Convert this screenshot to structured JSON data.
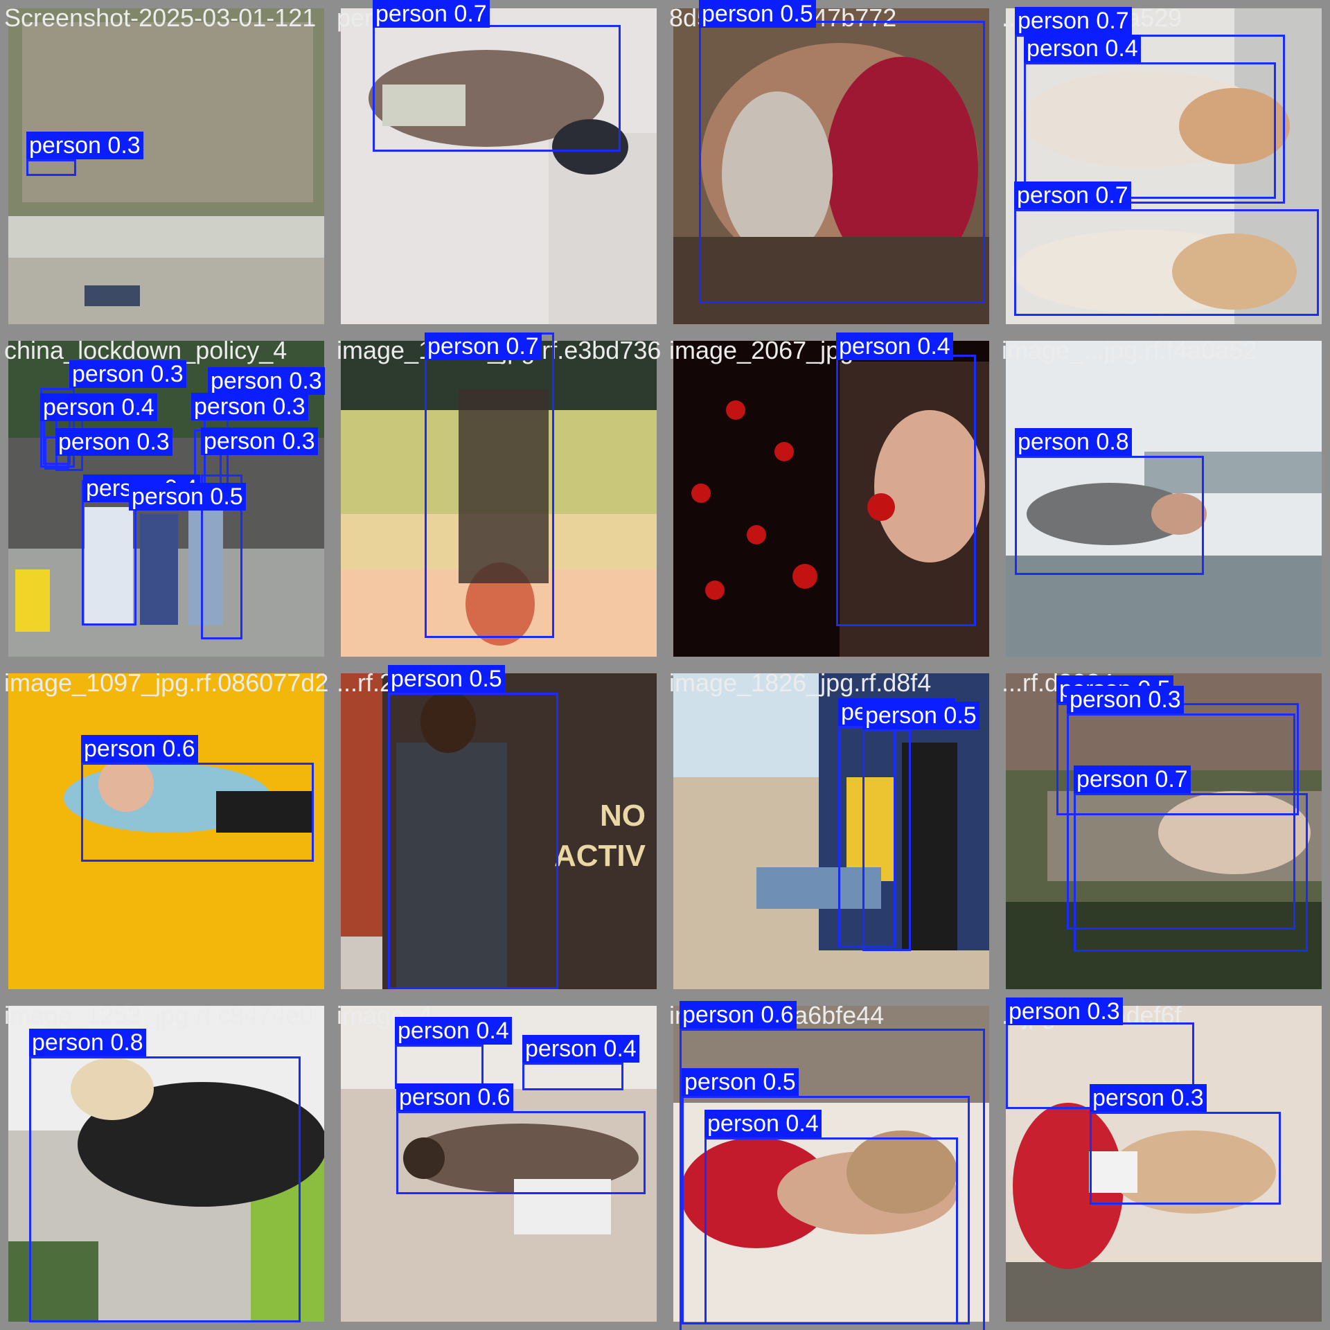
{
  "grid": {
    "rows": 4,
    "cols": 4
  },
  "colors": {
    "box": "#1a2bff",
    "label_bg": "#0a1eff",
    "label_text": "#ffffff",
    "tile_border": "#8e8e8e"
  },
  "tiles": [
    {
      "name": "Screenshot-2025-03-01-121",
      "scene": "aerial-courtyard",
      "detections": [
        {
          "label": "person 0.3"
        }
      ]
    },
    {
      "name": "person 0.7",
      "scene": "woman-puffer-jacket-rotated",
      "detections": [
        {
          "label": "person 0.7"
        }
      ]
    },
    {
      "name": "8d5ad ... .cbf47b772",
      "scene": "older-man-red-bandana",
      "detections": [
        {
          "label": "person 0.5"
        }
      ]
    },
    {
      "name": "...jpg.rf.2b5a529",
      "scene": "two-women-smiling-rotated",
      "detections": [
        {
          "label": "person 0.7"
        },
        {
          "label": "person 0.4"
        },
        {
          "label": "person 0.7"
        }
      ]
    },
    {
      "name": "china_lockdown_policy_4",
      "scene": "street-testing-crowd",
      "detections": [
        {
          "label": "person 0.3"
        },
        {
          "label": "person 0.4"
        },
        {
          "label": "person 0.3"
        },
        {
          "label": "person 0.3"
        },
        {
          "label": "person 0.3"
        },
        {
          "label": "person 0.3"
        },
        {
          "label": "person 0.4"
        },
        {
          "label": "person 0.5"
        }
      ]
    },
    {
      "name": "image_15043_jpg.rf.e3bd736",
      "scene": "silhouette-sunset-upside-down",
      "detections": [
        {
          "label": "person 0.7"
        }
      ]
    },
    {
      "name": "image_2067_jpg",
      "scene": "woman-red-network",
      "detections": [
        {
          "label": "person 0.4"
        }
      ]
    },
    {
      "name": "image_...jpg.rf.f4a0a52",
      "scene": "woman-city-rotated",
      "detections": [
        {
          "label": "person 0.8"
        }
      ]
    },
    {
      "name": "image_1097_jpg.rf.086077d2",
      "scene": "woman-headphones-yellow",
      "detections": [
        {
          "label": "person 0.6"
        }
      ]
    },
    {
      "name": "...rf.24e6e78",
      "scene": "man-phone-door",
      "detections": [
        {
          "label": "person 0.5"
        }
      ],
      "sign": "NO\nACTIV"
    },
    {
      "name": "image_1826_jpg.rf.d8f4",
      "scene": "woman-by-truck-tire",
      "detections": [
        {
          "label": "person 0.5"
        },
        {
          "label": "person 0.5"
        }
      ]
    },
    {
      "name": "...rf.d3024",
      "scene": "woman-lying-rotated",
      "detections": [
        {
          "label": "person 0.5"
        },
        {
          "label": "person 0.3"
        },
        {
          "label": "person 0.7"
        }
      ]
    },
    {
      "name": "image_1253_jpg.rf.c8474e0",
      "scene": "yoga-woman-rotated",
      "detections": [
        {
          "label": "person 0.8"
        }
      ]
    },
    {
      "name": "image_4...",
      "scene": "street-woman-rotated",
      "detections": [
        {
          "label": "person 0.4"
        },
        {
          "label": "person 0.4"
        },
        {
          "label": "person 0.6"
        }
      ]
    },
    {
      "name": "image_...rf.a6bfe44",
      "scene": "woman-red-swimsuit-rotated",
      "detections": [
        {
          "label": "person 0.6"
        },
        {
          "label": "person 0.5"
        },
        {
          "label": "person 0.4"
        }
      ]
    },
    {
      "name": "...jpg.rf.9ff5def6f",
      "scene": "woman-mug-rotated",
      "detections": [
        {
          "label": "person 0.3"
        },
        {
          "label": "person 0.3"
        }
      ]
    }
  ]
}
